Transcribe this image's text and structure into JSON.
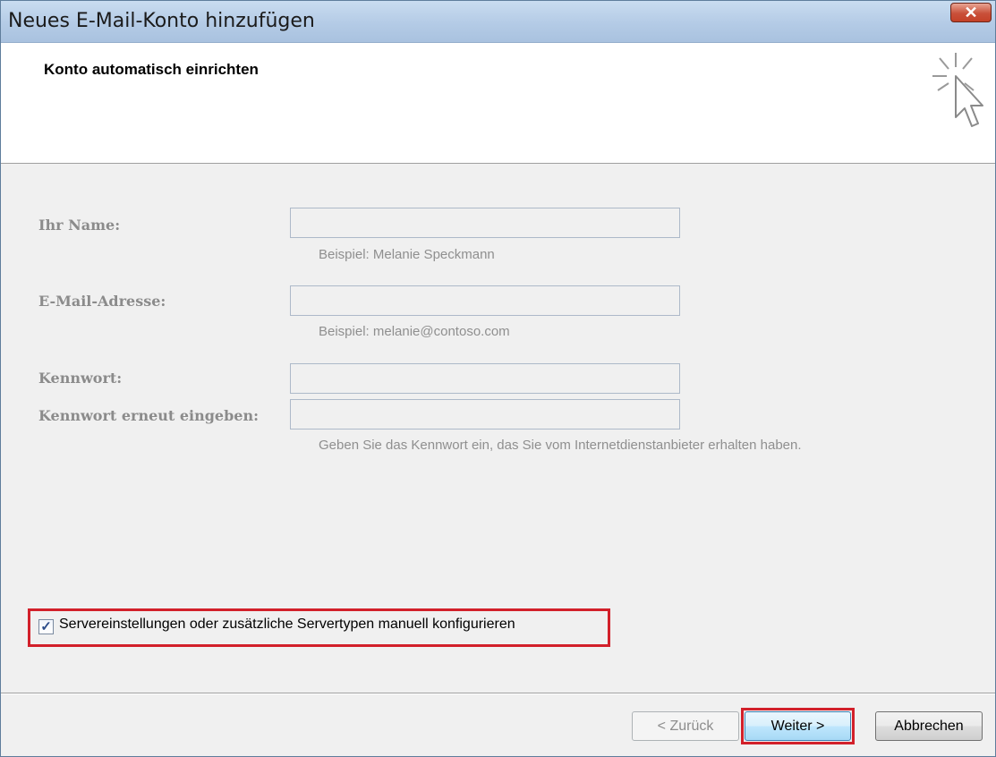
{
  "window": {
    "title": "Neues E-Mail-Konto hinzufügen",
    "close_glyph": "✕"
  },
  "header": {
    "title": "Konto automatisch einrichten",
    "icon": "cursor-click-icon"
  },
  "form": {
    "name": {
      "label": "Ihr Name:",
      "value": "",
      "hint": "Beispiel: Melanie Speckmann"
    },
    "email": {
      "label": "E-Mail-Adresse:",
      "value": "",
      "hint": "Beispiel: melanie@contoso.com"
    },
    "password": {
      "label": "Kennwort:",
      "value": ""
    },
    "password_repeat": {
      "label": "Kennwort erneut eingeben:",
      "value": ""
    },
    "password_hint": "Geben Sie das Kennwort ein, das Sie vom Internetdienstanbieter erhalten haben."
  },
  "manual_config": {
    "label": "Servereinstellungen oder zusätzliche Servertypen manuell konfigurieren",
    "checked": true,
    "check_glyph": "✓"
  },
  "buttons": {
    "back": "< Zurück",
    "next": "Weiter >",
    "cancel": "Abbrechen"
  },
  "colors": {
    "highlight": "#d2202a",
    "dialog_bg": "#f0f0f0",
    "disabled_text": "#8b8b8b"
  }
}
